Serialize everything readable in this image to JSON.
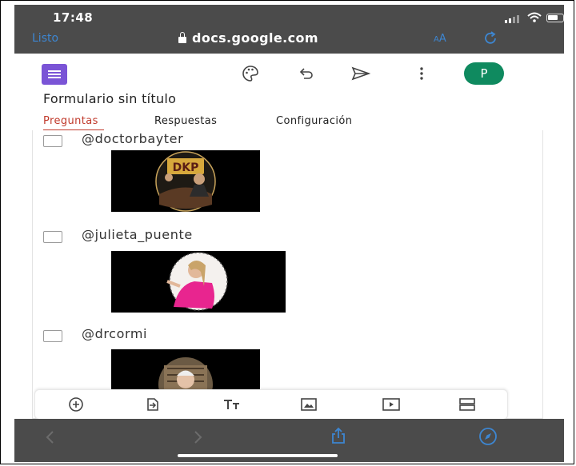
{
  "status_bar": {
    "time": "17:48"
  },
  "browser": {
    "done_label": "Listo",
    "url": "docs.google.com",
    "text_size_label_small": "A",
    "text_size_label_large": "A"
  },
  "forms_header": {
    "avatar_letter": "P",
    "form_title": "Formulario sin título",
    "tabs": [
      "Preguntas",
      "Respuestas",
      "Configuración"
    ],
    "active_tab": "Preguntas"
  },
  "options": [
    {
      "label": "@doctorbayter",
      "checked": false
    },
    {
      "label": "@julieta_puente",
      "checked": false
    },
    {
      "label": "@drcormi",
      "checked": false
    }
  ],
  "thumbnail_texts": {
    "dkp_logo": "DKP"
  },
  "edit_toolbar": {
    "icons": [
      "add-question-icon",
      "import-questions-icon",
      "add-title-icon",
      "add-image-icon",
      "add-video-icon",
      "add-section-icon"
    ]
  },
  "colors": {
    "accent": "#3d86d1",
    "forms_purple": "#7a54d6",
    "tab_active": "#c0392b",
    "avatar": "#0f8a5f",
    "browser_chrome": "#4b4b4b"
  }
}
